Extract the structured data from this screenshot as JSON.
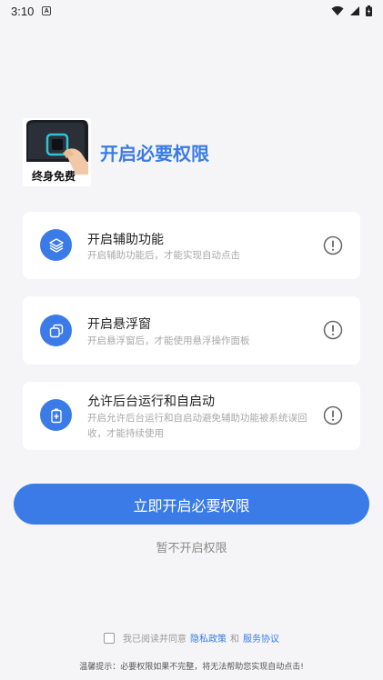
{
  "status_bar": {
    "time": "3:10",
    "notification_glyph": "A"
  },
  "header": {
    "logo_caption": "终身免费",
    "title": "开启必要权限"
  },
  "cards": [
    {
      "title": "开启辅助功能",
      "description": "开启辅助功能后，才能实现自动点击",
      "icon": "layers-icon"
    },
    {
      "title": "开启悬浮窗",
      "description": "开启悬浮窗后，才能使用悬浮操作面板",
      "icon": "overlay-icon"
    },
    {
      "title": "允许后台运行和自启动",
      "description": "开启允许后台运行和自启动避免辅助功能被系统误回收，才能持续使用",
      "icon": "battery-icon"
    }
  ],
  "actions": {
    "primary_label": "立即开启必要权限",
    "secondary_label": "暂不开启权限"
  },
  "agreement": {
    "prefix": "我已阅读并同意",
    "privacy_link": "隐私政策",
    "conjunction": "和",
    "service_link": "服务协议"
  },
  "tip": "温馨提示：必要权限如果不完整，将无法帮助您实现自动点击!",
  "colors": {
    "accent": "#3a7be8",
    "background": "#f5f5f7"
  }
}
